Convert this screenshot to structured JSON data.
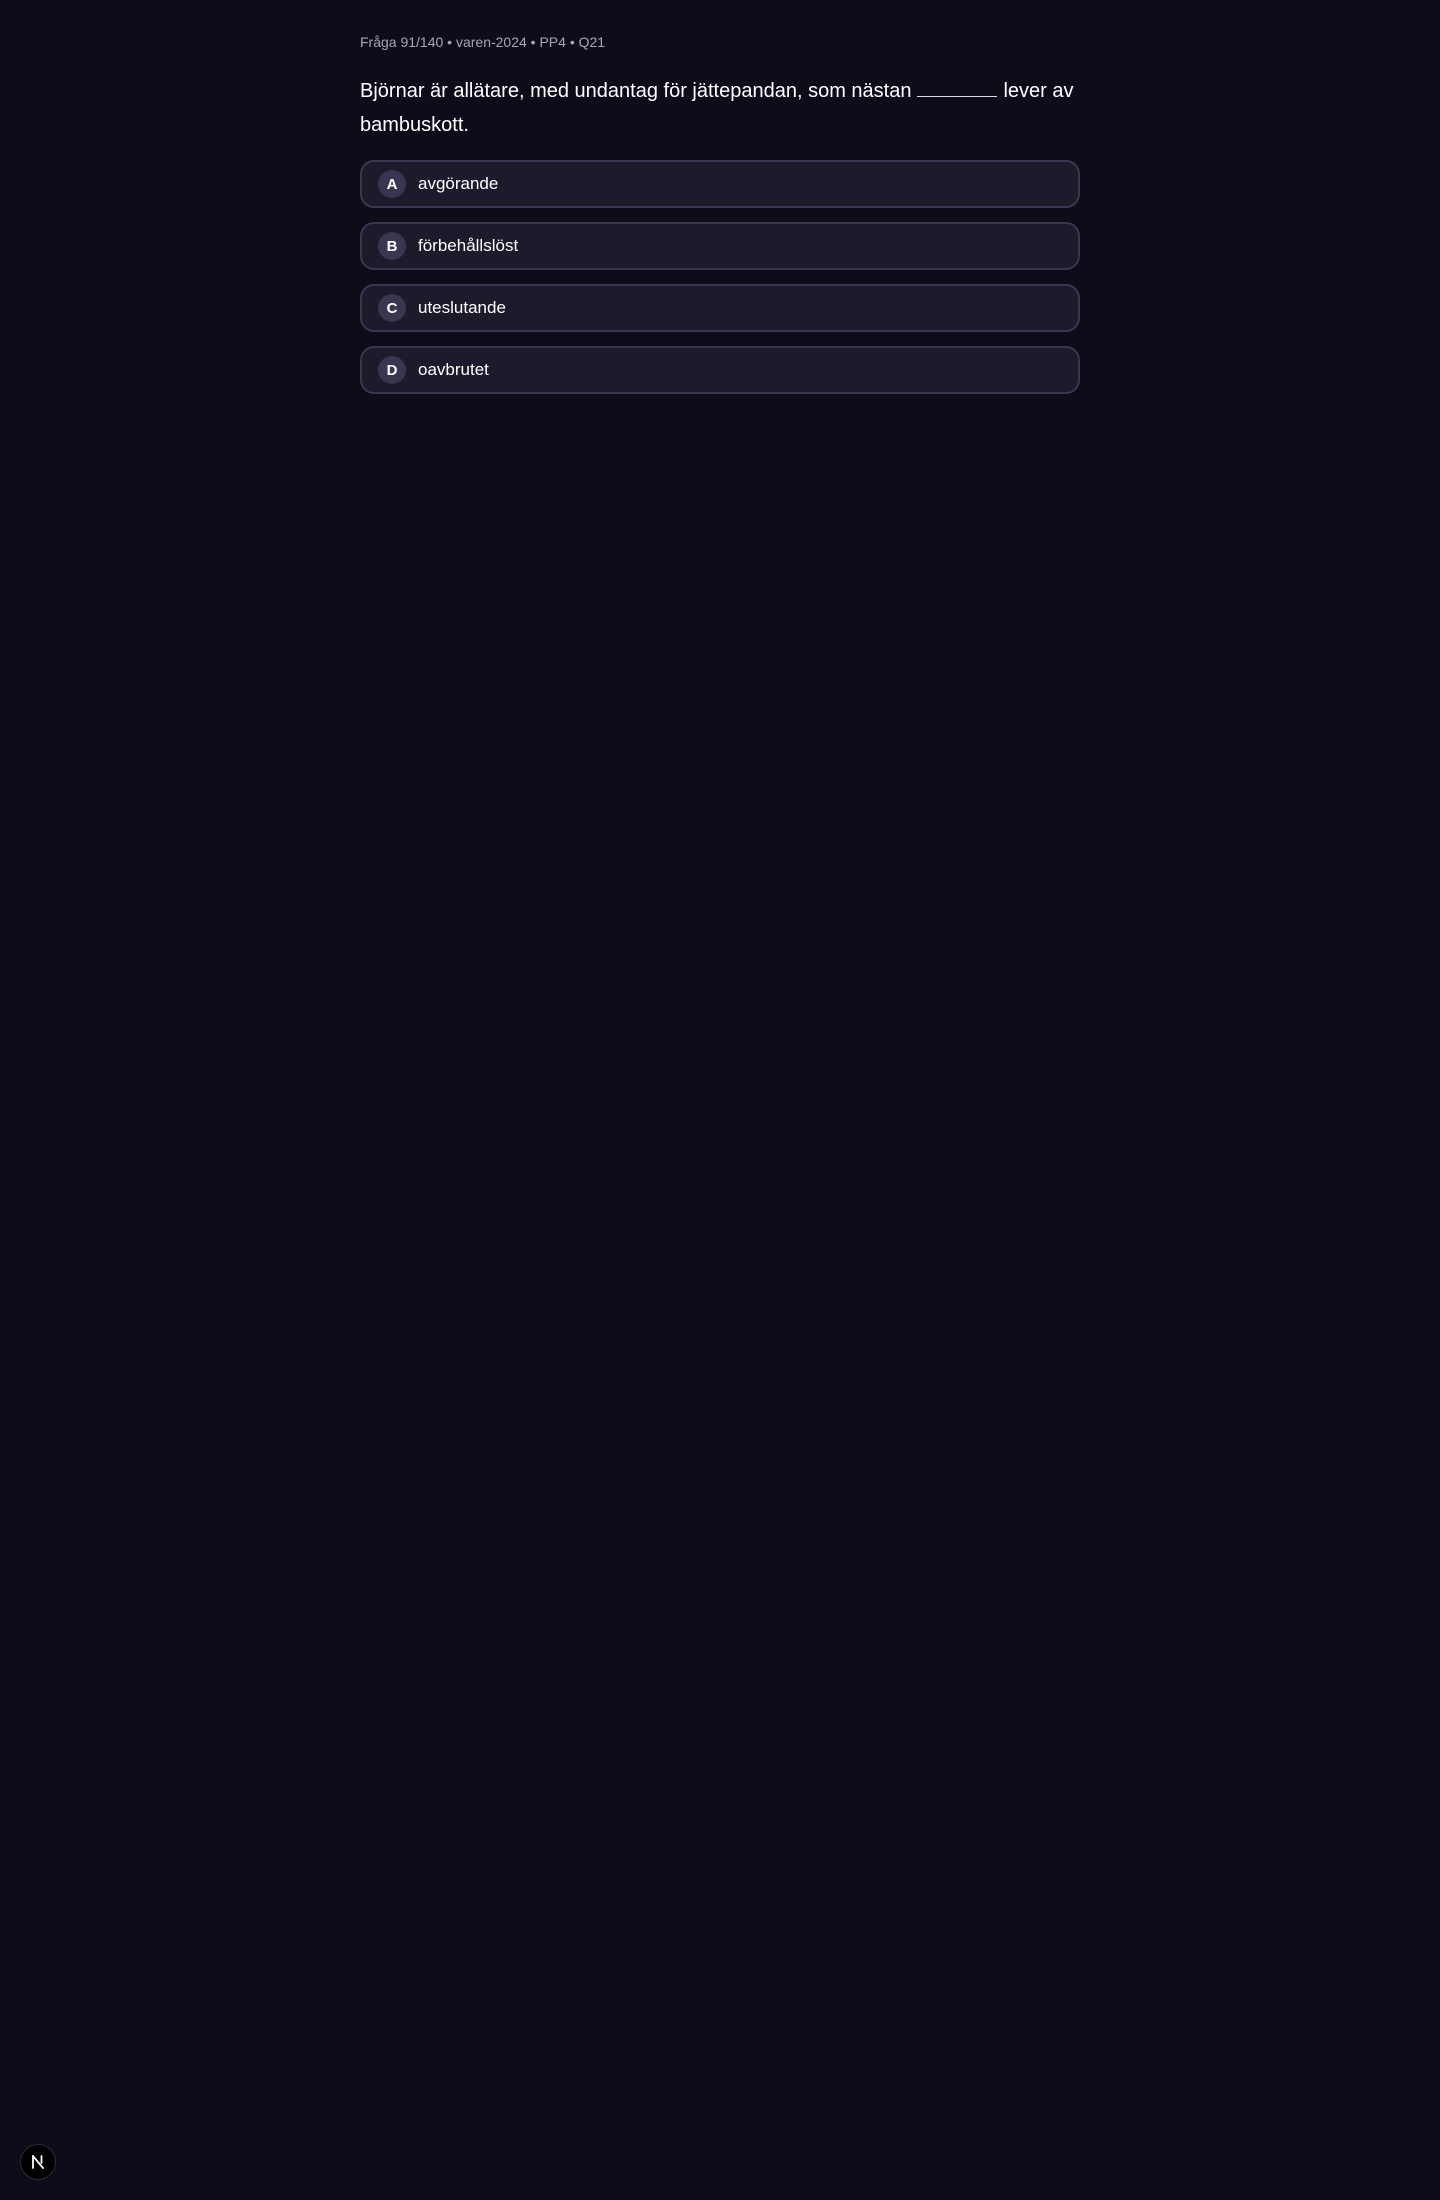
{
  "header": {
    "meta": "Fråga 91/140 • varen-2024 • PP4 • Q21"
  },
  "question": {
    "before": "Björnar är allätare, med undantag för jättepandan, som nästan",
    "after": "lever av bambuskott."
  },
  "options": [
    {
      "letter": "A",
      "text": "avgörande"
    },
    {
      "letter": "B",
      "text": "förbehållslöst"
    },
    {
      "letter": "C",
      "text": "uteslutande"
    },
    {
      "letter": "D",
      "text": "oavbrutet"
    }
  ],
  "colors": {
    "background": "#0e0c18",
    "option_bg": "#1c1a2b",
    "option_border": "#3a3650",
    "badge_bg": "#3a3650",
    "meta_text": "#a8a5b8"
  },
  "floating_button": {
    "icon": "nextjs-logo-icon"
  }
}
